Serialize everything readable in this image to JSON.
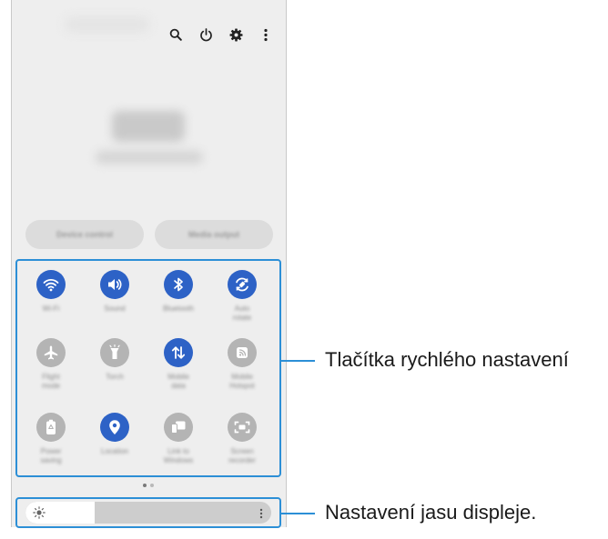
{
  "colors": {
    "accent_on": "#2d62c6",
    "tile_off": "#b4b4b4",
    "callout": "#2c8fd6"
  },
  "header_icons": [
    "search-icon",
    "power-icon",
    "gear-icon",
    "more-vertical-icon"
  ],
  "media": {
    "device_control_label": "Device control",
    "media_output_label": "Media output"
  },
  "tiles": [
    {
      "label": "Wi-Fi",
      "icon": "wifi-icon",
      "state": "on"
    },
    {
      "label": "Sound",
      "icon": "sound-icon",
      "state": "on"
    },
    {
      "label": "Bluetooth",
      "icon": "bluetooth-icon",
      "state": "on"
    },
    {
      "label": "Auto\nrotate",
      "icon": "rotate-icon",
      "state": "on"
    },
    {
      "label": "Flight\nmode",
      "icon": "airplane-icon",
      "state": "off"
    },
    {
      "label": "Torch",
      "icon": "flashlight-icon",
      "state": "off"
    },
    {
      "label": "Mobile\ndata",
      "icon": "mobile-data-icon",
      "state": "on"
    },
    {
      "label": "Mobile\nHotspot",
      "icon": "hotspot-icon",
      "state": "off"
    },
    {
      "label": "Power\nsaving",
      "icon": "battery-saver-icon",
      "state": "off"
    },
    {
      "label": "Location",
      "icon": "location-icon",
      "state": "on"
    },
    {
      "label": "Link to\nWindows",
      "icon": "link-windows-icon",
      "state": "off"
    },
    {
      "label": "Screen\nrecorder",
      "icon": "screen-recorder-icon",
      "state": "off"
    }
  ],
  "page_indicator": {
    "current": 1,
    "total": 2
  },
  "brightness": {
    "level": 0.28
  },
  "callouts": {
    "quick_settings": "Tlačítka rychlého nastavení",
    "brightness": "Nastavení jasu displeje."
  }
}
